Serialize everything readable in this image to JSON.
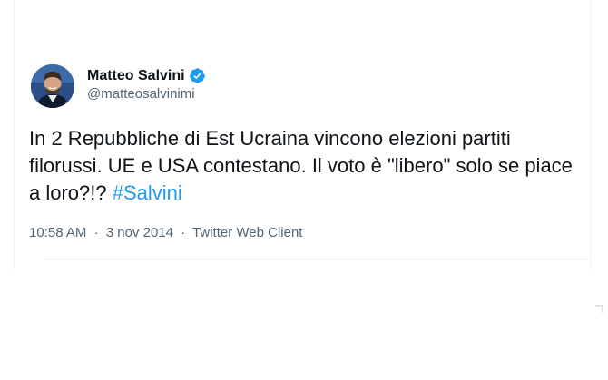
{
  "tweet": {
    "author": {
      "name": "Matteo Salvini",
      "handle": "@matteosalvinimi",
      "verified": true
    },
    "text_main": "In 2 Repubbliche di Est Ucraina vincono elezioni partiti filorussi. UE e USA contestano. Il voto è \"libero\" solo se piace a loro?!? ",
    "hashtag": "#Salvini",
    "time": "10:58 AM",
    "date": "3 nov 2014",
    "client": "Twitter Web Client",
    "separator": "·"
  },
  "colors": {
    "text": "#0f1419",
    "secondary": "#536471",
    "accent": "#1d9bf0",
    "divider": "#eff3f4"
  },
  "icons": {
    "verified": "verified-badge-icon",
    "avatar": "profile-photo"
  }
}
